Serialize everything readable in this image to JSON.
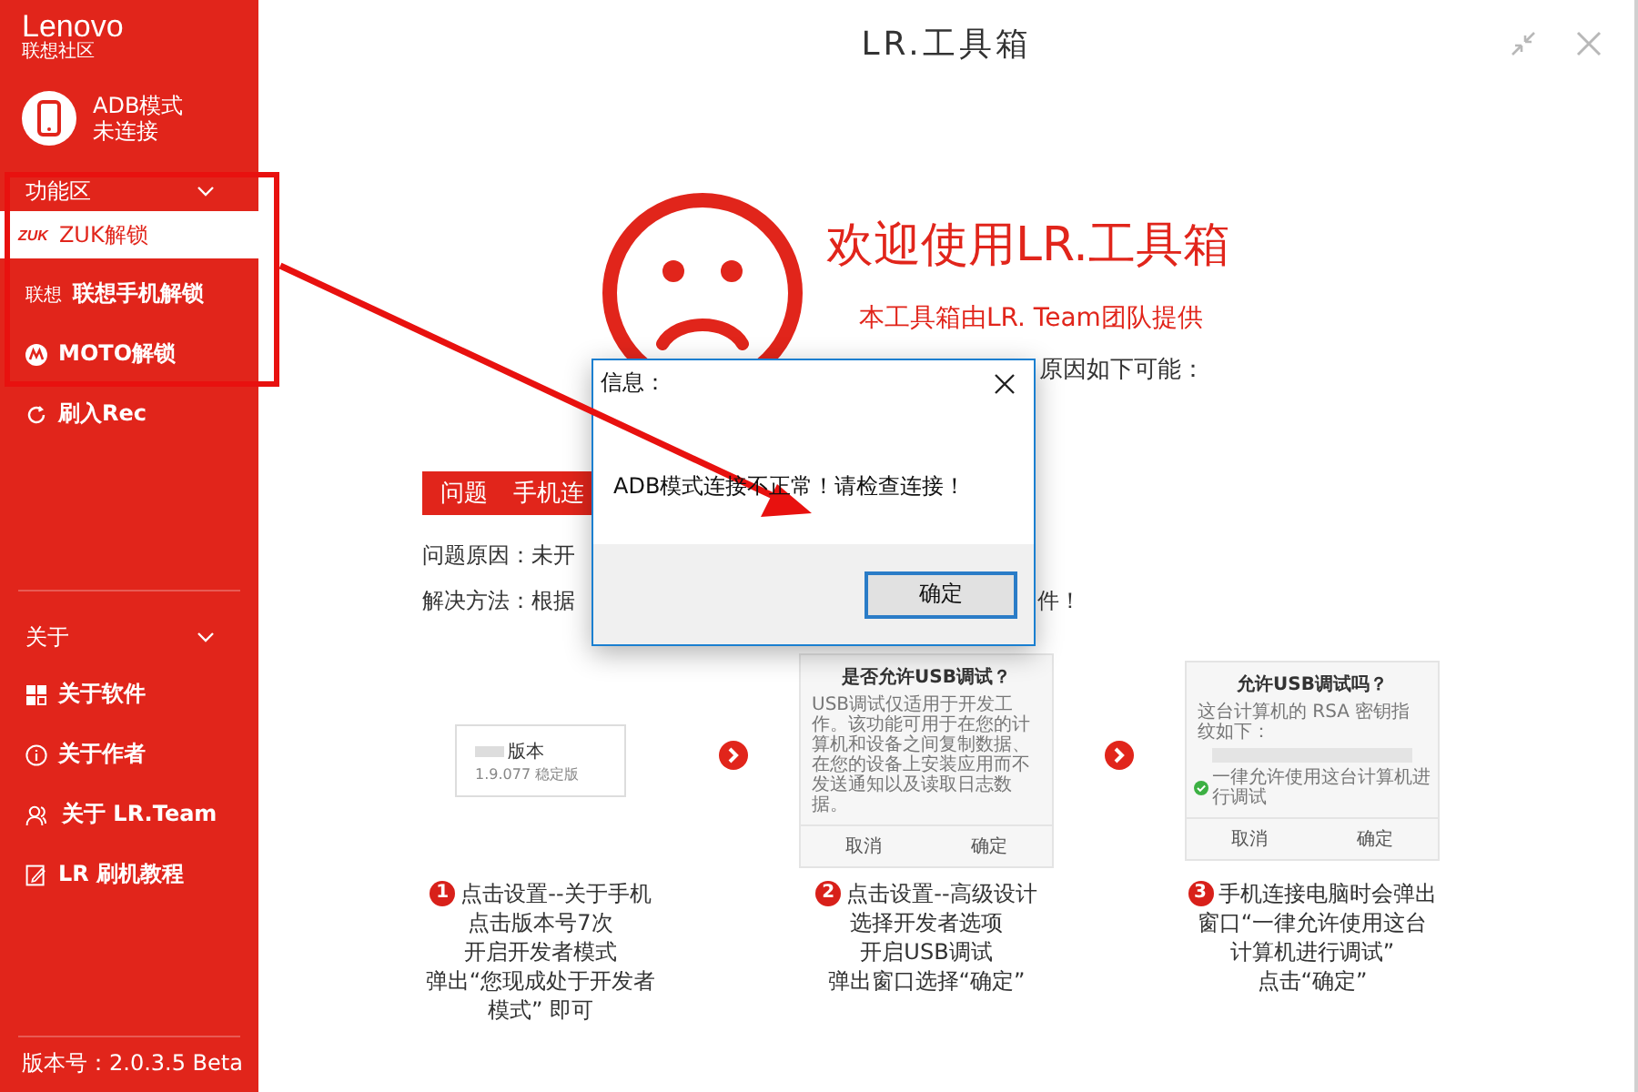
{
  "window": {
    "title": "LR.工具箱"
  },
  "sidebar": {
    "logo": "Lenovo",
    "logo_sub": "联想社区",
    "device": {
      "mode": "ADB模式",
      "status": "未连接"
    },
    "sections": [
      {
        "title": "功能区",
        "items": [
          {
            "kind": "zuk",
            "icon_text": "ZUK",
            "label": "ZUK解锁",
            "selected": true
          },
          {
            "kind": "lenovo",
            "icon_text": "联想",
            "label": "联想手机解锁",
            "selected": false
          },
          {
            "kind": "moto",
            "label": "MOTO解锁",
            "selected": false
          },
          {
            "kind": "refresh",
            "label": "刷入Rec",
            "selected": false
          }
        ]
      },
      {
        "title": "关于",
        "items": [
          {
            "kind": "grid",
            "label": "关于软件",
            "selected": false
          },
          {
            "kind": "info",
            "label": "关于作者",
            "selected": false
          },
          {
            "kind": "people",
            "label": "关于 LR.Team",
            "selected": false
          },
          {
            "kind": "note",
            "label": "LR 刷机教程",
            "selected": false
          }
        ]
      }
    ],
    "version": "版本号：2.0.3.5 Beta"
  },
  "main": {
    "welcome": "欢迎使用LR.工具箱",
    "provider": "本工具箱由LR. Team团队提供",
    "reason_tail": "原因如下可能：",
    "problem_bar": {
      "label": "问题",
      "detail": "手机连"
    },
    "cause": "问题原因：未开",
    "solution": "解决方法：根据",
    "solution_tail": "件！",
    "steps": [
      {
        "number": "1",
        "screen": {
          "kind": "version",
          "title": "版本",
          "subtitle": "1.9.077 稳定版"
        },
        "caption": [
          "点击设置--关于手机",
          "点击版本号7次",
          "开启开发者模式",
          "弹出“您现成处于开发者",
          "模式” 即可"
        ]
      },
      {
        "number": "2",
        "screen": {
          "kind": "prompt",
          "title": "是否允许USB调试？",
          "body": "USB调试仅适用于开发工作。该功能可用于在您的计算机和设备之间复制数据、在您的设备上安装应用而不发送通知以及读取日志数据。",
          "buttons": [
            "取消",
            "确定"
          ]
        },
        "caption": [
          "点击设置--高级设计",
          "选择开发者选项",
          "开启USB调试",
          "弹出窗口选择“确定”"
        ]
      },
      {
        "number": "3",
        "screen": {
          "kind": "rsa",
          "title": "允许USB调试吗？",
          "body": "这台计算机的 RSA 密钥指纹如下：",
          "check": "一律允许使用这台计算机进行调试",
          "buttons": [
            "取消",
            "确定"
          ]
        },
        "caption": [
          "手机连接电脑时会弹出",
          "窗口“一律允许使用这台",
          "计算机进行调试”",
          "点击“确定”"
        ]
      }
    ]
  },
  "dialog": {
    "title": "信息：",
    "message": "ADB模式连接不正常！请检查连接！",
    "button": "确定"
  }
}
